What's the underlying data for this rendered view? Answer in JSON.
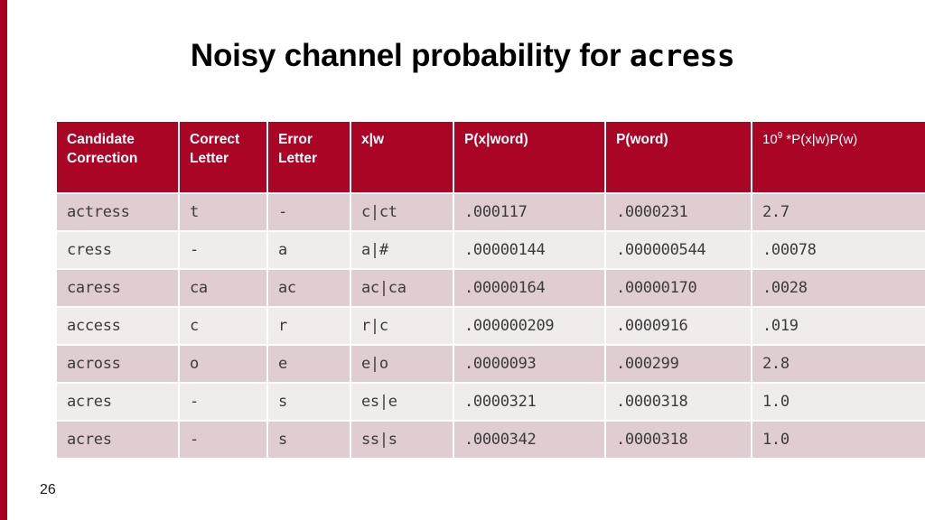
{
  "slide": {
    "title_prefix": "Noisy channel probability for ",
    "title_word": "acress",
    "number": "26",
    "accent_color": "#a50021",
    "header_color": "#ab0526",
    "row_dark_color": "#e0cdd2",
    "row_light_color": "#f0ecec"
  },
  "table": {
    "headers": [
      {
        "line1": "Candidate",
        "line2": "Correction"
      },
      {
        "line1": "Correct",
        "line2": "Letter"
      },
      {
        "line1": "Error",
        "line2": "Letter"
      },
      {
        "line1": "x|w",
        "line2": ""
      },
      {
        "line1": "P(x|word)",
        "line2": ""
      },
      {
        "line1": "P(word)",
        "line2": ""
      },
      {
        "line1": "10",
        "sup": "9",
        "line1b": " *P(x|w)P(w)",
        "line2": ""
      }
    ],
    "rows": [
      {
        "candidate": "actress",
        "correct_letter": "t",
        "error_letter": "-",
        "x_given_w": "c|ct",
        "p_x_word": ".000117",
        "p_word": ".0000231",
        "product": "2.7"
      },
      {
        "candidate": "cress",
        "correct_letter": "-",
        "error_letter": "a",
        "x_given_w": "a|#",
        "p_x_word": ".00000144",
        "p_word": ".000000544",
        "product": ".00078"
      },
      {
        "candidate": "caress",
        "correct_letter": "ca",
        "error_letter": "ac",
        "x_given_w": "ac|ca",
        "p_x_word": ".00000164",
        "p_word": ".00000170",
        "product": ".0028"
      },
      {
        "candidate": "access",
        "correct_letter": "c",
        "error_letter": "r",
        "x_given_w": "r|c",
        "p_x_word": ".000000209",
        "p_word": ".0000916",
        "product": ".019"
      },
      {
        "candidate": "across",
        "correct_letter": "o",
        "error_letter": "e",
        "x_given_w": "e|o",
        "p_x_word": ".0000093",
        "p_word": ".000299",
        "product": "2.8"
      },
      {
        "candidate": "acres",
        "correct_letter": "-",
        "error_letter": "s",
        "x_given_w": "es|e",
        "p_x_word": ".0000321",
        "p_word": ".0000318",
        "product": "1.0"
      },
      {
        "candidate": "acres",
        "correct_letter": "-",
        "error_letter": "s",
        "x_given_w": "ss|s",
        "p_x_word": ".0000342",
        "p_word": ".0000318",
        "product": "1.0"
      }
    ]
  }
}
